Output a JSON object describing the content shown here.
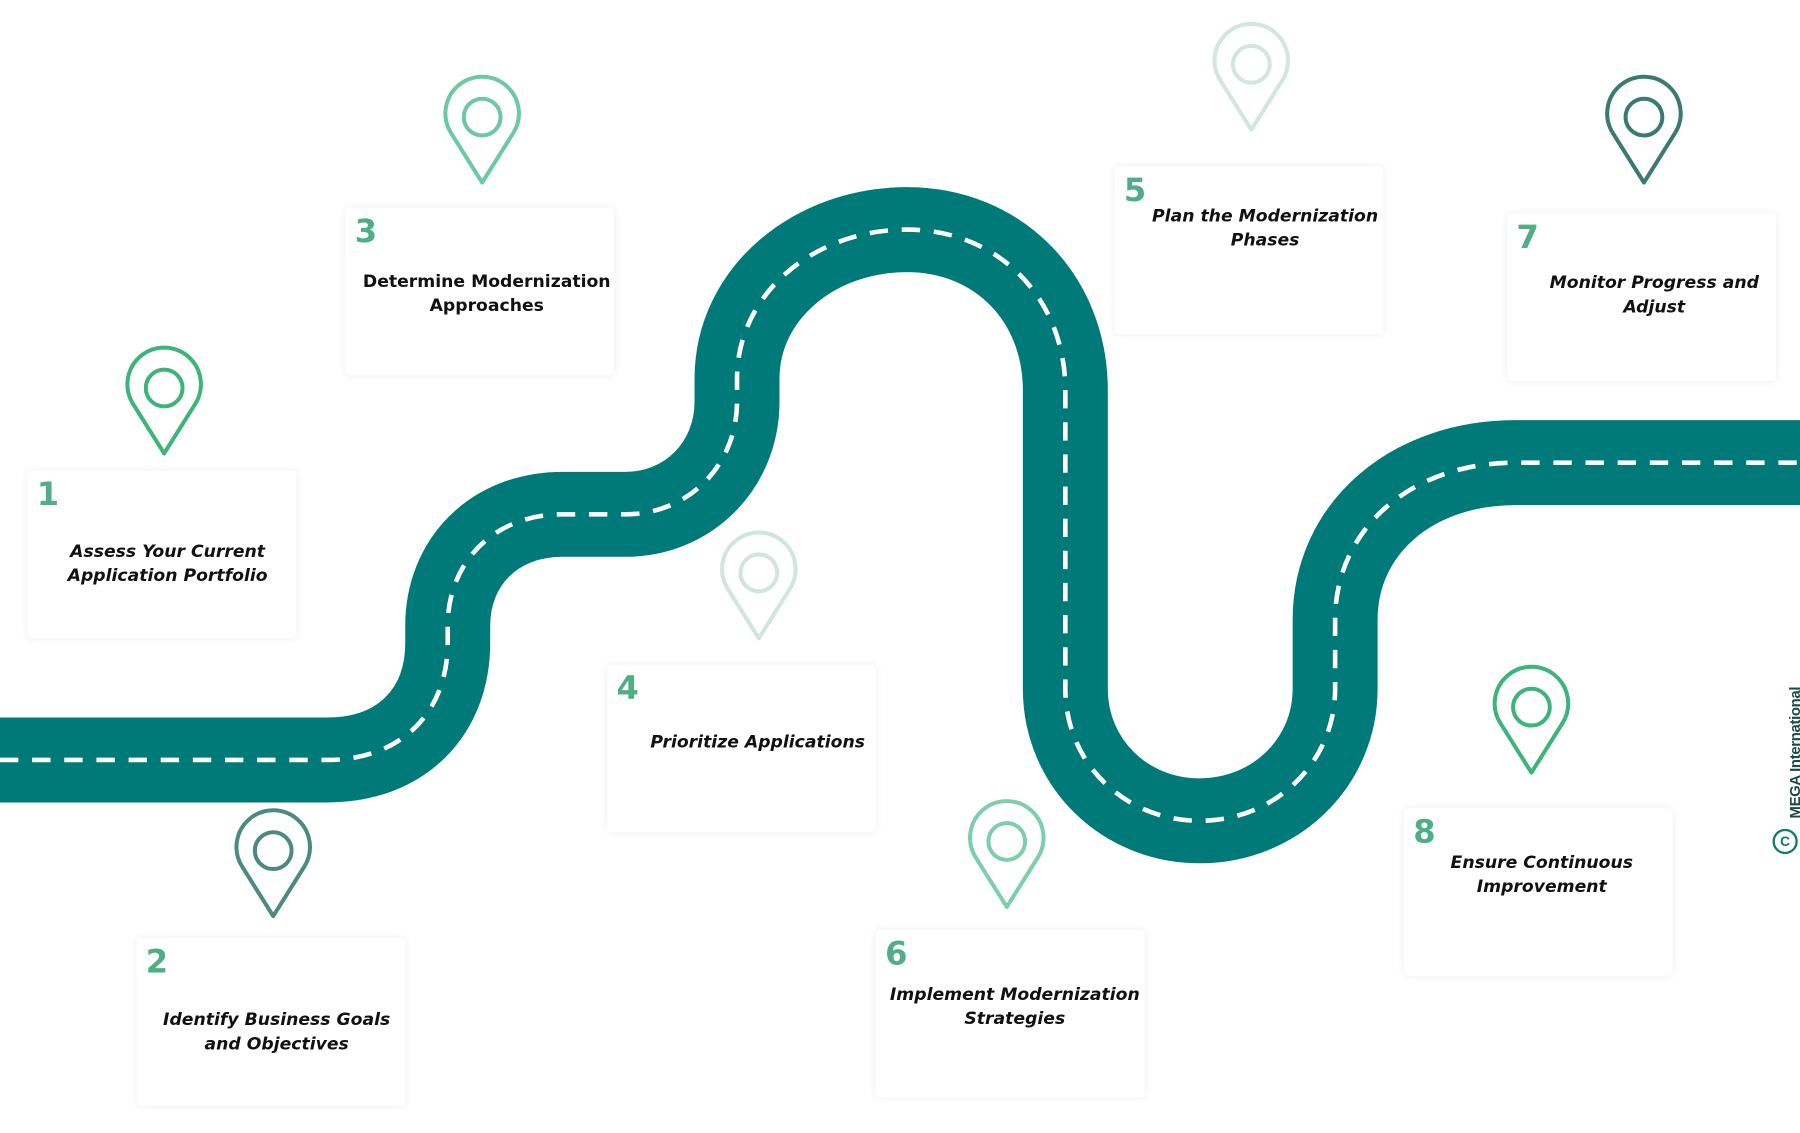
{
  "colors": {
    "road": "#007a78",
    "road_dash": "#ffffff",
    "number": "#4fae86",
    "text": "#111111"
  },
  "steps": [
    {
      "number": "1",
      "title": "Assess Your Current Application Portfolio",
      "pin_color": "#3db479"
    },
    {
      "number": "2",
      "title": "Identify Business Goals and Objectives",
      "pin_color": "#4a8a80"
    },
    {
      "number": "3",
      "title": "Determine Modernization Approaches",
      "pin_color": "#6cc9a0"
    },
    {
      "number": "4",
      "title": "Prioritize Applications",
      "pin_color": "#cfe6dd"
    },
    {
      "number": "5",
      "title": "Plan the Modernization Phases",
      "pin_color": "#d0e6de"
    },
    {
      "number": "6",
      "title": "Implement Modernization Strategies",
      "pin_color": "#7dcfaa"
    },
    {
      "number": "7",
      "title": "Monitor Progress and Adjust",
      "pin_color": "#3a7a72"
    },
    {
      "number": "8",
      "title": "Ensure Continuous Improvement",
      "pin_color": "#3db479"
    }
  ],
  "watermark": {
    "text": "MEGA International",
    "symbol": "C"
  }
}
